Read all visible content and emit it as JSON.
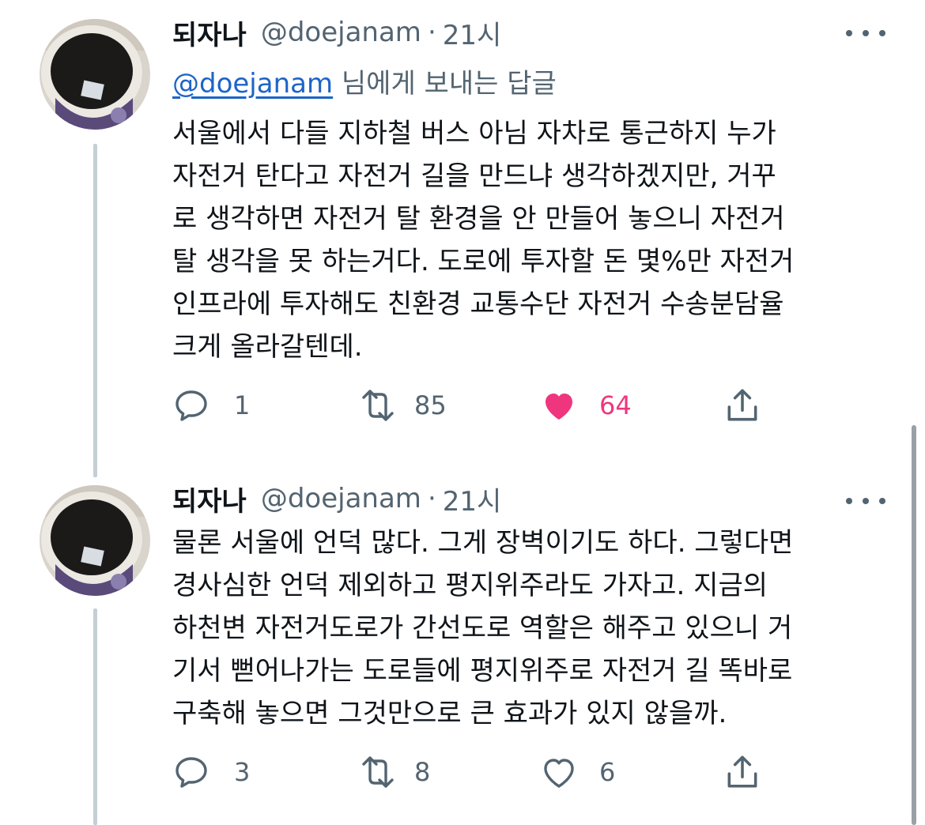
{
  "tweets": [
    {
      "author_name": "되자나",
      "handle": "@doejanam",
      "separator": "·",
      "time": "21시",
      "reply_to_handle": "@doejanam",
      "reply_to_suffix": " 님에게 보내는 답글",
      "text_lines": [
        "서울에서 다들 지하철 버스 아님 자차로 통근하지 누가",
        "자전거 탄다고 자전거 길을 만드냐 생각하겠지만, 거꾸",
        "로 생각하면 자전거 탈 환경을 안 만들어 놓으니 자전거",
        "탈 생각을 못 하는거다. 도로에 투자할 돈 몇%만 자전거",
        "인프라에 투자해도 친환경 교통수단 자전거 수송분담율",
        "크게 올라갈텐데."
      ],
      "replies": "1",
      "retweets": "85",
      "likes": "64",
      "liked": true
    },
    {
      "author_name": "되자나",
      "handle": "@doejanam",
      "separator": "·",
      "time": "21시",
      "text_lines": [
        "물론 서울에 언덕 많다. 그게 장벽이기도 하다. 그렇다면",
        "경사심한 언덕 제외하고 평지위주라도 가자고. 지금의",
        "하천변 자전거도로가 간선도로 역할은 해주고 있으니 거",
        "기서 뻗어나가는 도로들에 평지위주로 자전거 길 똑바로",
        "구축해 놓으면 그것만으로 큰 효과가 있지 않을까."
      ],
      "replies": "3",
      "retweets": "8",
      "likes": "6",
      "liked": false
    }
  ],
  "colors": {
    "text": "#0f1419",
    "secondary": "#536471",
    "mention": "#1d64c8",
    "like_active": "#f0357f",
    "thread_line": "#c4cfd6"
  },
  "icons": [
    "coffee-cup-avatar",
    "more-icon",
    "reply-icon",
    "retweet-icon",
    "heart-icon",
    "share-icon"
  ]
}
